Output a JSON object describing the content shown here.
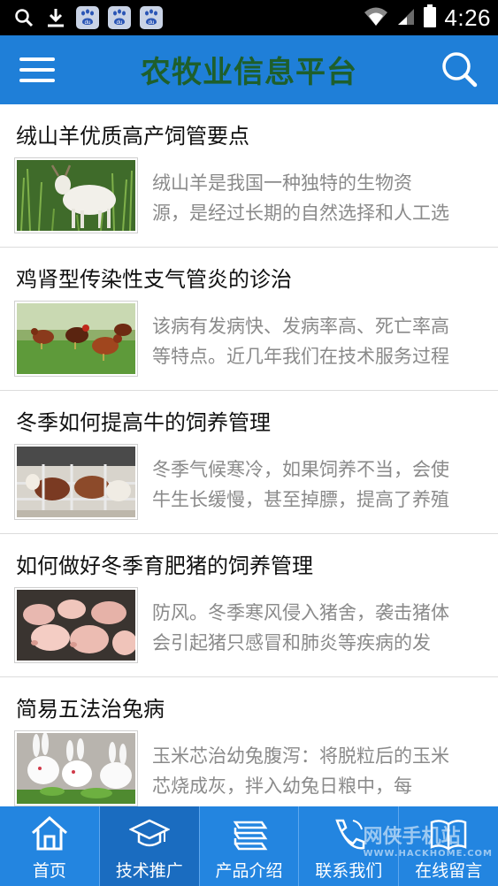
{
  "status_bar": {
    "time": "4:26",
    "baidu_label": "du"
  },
  "header": {
    "title": "农牧业信息平台"
  },
  "articles": [
    {
      "title": "绒山羊优质高产饲管要点",
      "summary_line1": "绒山羊是我国一种独特的生物资",
      "summary_line2": "源，是经过长期的自然选择和人工选",
      "image": "goat-photo"
    },
    {
      "title": "鸡肾型传染性支气管炎的诊治",
      "summary_line1": "该病有发病快、发病率高、死亡率高",
      "summary_line2": "等特点。近几年我们在技术服务过程",
      "image": "chickens-photo"
    },
    {
      "title": "冬季如何提高牛的饲养管理",
      "summary_line1": "冬季气候寒冷，如果饲养不当，会使",
      "summary_line2": "牛生长缓慢，甚至掉膘，提高了养殖",
      "image": "cattle-photo"
    },
    {
      "title": "如何做好冬季育肥猪的饲养管理",
      "summary_line1": "防风。冬季寒风侵入猪舍，袭击猪体",
      "summary_line2": "会引起猪只感冒和肺炎等疾病的发",
      "image": "pigs-photo"
    },
    {
      "title": "简易五法治兔病",
      "summary_line1": "玉米芯治幼兔腹泻：将脱粒后的玉米",
      "summary_line2": "芯烧成灰，拌入幼兔日粮中，每",
      "image": "rabbits-photo"
    }
  ],
  "bottom_nav": [
    {
      "label": "首页",
      "icon": "home-icon"
    },
    {
      "label": "技术推广",
      "icon": "graduation-cap-icon"
    },
    {
      "label": "产品介绍",
      "icon": "stack-icon"
    },
    {
      "label": "联系我们",
      "icon": "phone-icon"
    },
    {
      "label": "在线留言",
      "icon": "book-icon"
    }
  ],
  "watermark": {
    "text": "网侠手机站",
    "sub": "WWW.HACKHOME.COM"
  },
  "colors": {
    "header_bg": "#1f7fd8",
    "title_green": "#1e5f2c",
    "nav_bg": "#2385e0",
    "nav_active": "#1a6cc0"
  }
}
